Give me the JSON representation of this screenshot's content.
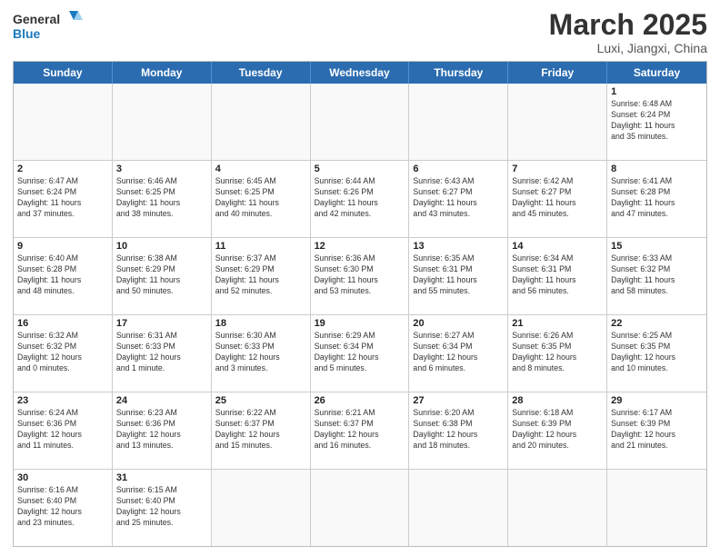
{
  "header": {
    "logo_general": "General",
    "logo_blue": "Blue",
    "month_title": "March 2025",
    "subtitle": "Luxi, Jiangxi, China"
  },
  "weekdays": [
    "Sunday",
    "Monday",
    "Tuesday",
    "Wednesday",
    "Thursday",
    "Friday",
    "Saturday"
  ],
  "weeks": [
    [
      {
        "day": "",
        "info": ""
      },
      {
        "day": "",
        "info": ""
      },
      {
        "day": "",
        "info": ""
      },
      {
        "day": "",
        "info": ""
      },
      {
        "day": "",
        "info": ""
      },
      {
        "day": "",
        "info": ""
      },
      {
        "day": "1",
        "info": "Sunrise: 6:48 AM\nSunset: 6:24 PM\nDaylight: 11 hours\nand 35 minutes."
      }
    ],
    [
      {
        "day": "2",
        "info": "Sunrise: 6:47 AM\nSunset: 6:24 PM\nDaylight: 11 hours\nand 37 minutes."
      },
      {
        "day": "3",
        "info": "Sunrise: 6:46 AM\nSunset: 6:25 PM\nDaylight: 11 hours\nand 38 minutes."
      },
      {
        "day": "4",
        "info": "Sunrise: 6:45 AM\nSunset: 6:25 PM\nDaylight: 11 hours\nand 40 minutes."
      },
      {
        "day": "5",
        "info": "Sunrise: 6:44 AM\nSunset: 6:26 PM\nDaylight: 11 hours\nand 42 minutes."
      },
      {
        "day": "6",
        "info": "Sunrise: 6:43 AM\nSunset: 6:27 PM\nDaylight: 11 hours\nand 43 minutes."
      },
      {
        "day": "7",
        "info": "Sunrise: 6:42 AM\nSunset: 6:27 PM\nDaylight: 11 hours\nand 45 minutes."
      },
      {
        "day": "8",
        "info": "Sunrise: 6:41 AM\nSunset: 6:28 PM\nDaylight: 11 hours\nand 47 minutes."
      }
    ],
    [
      {
        "day": "9",
        "info": "Sunrise: 6:40 AM\nSunset: 6:28 PM\nDaylight: 11 hours\nand 48 minutes."
      },
      {
        "day": "10",
        "info": "Sunrise: 6:38 AM\nSunset: 6:29 PM\nDaylight: 11 hours\nand 50 minutes."
      },
      {
        "day": "11",
        "info": "Sunrise: 6:37 AM\nSunset: 6:29 PM\nDaylight: 11 hours\nand 52 minutes."
      },
      {
        "day": "12",
        "info": "Sunrise: 6:36 AM\nSunset: 6:30 PM\nDaylight: 11 hours\nand 53 minutes."
      },
      {
        "day": "13",
        "info": "Sunrise: 6:35 AM\nSunset: 6:31 PM\nDaylight: 11 hours\nand 55 minutes."
      },
      {
        "day": "14",
        "info": "Sunrise: 6:34 AM\nSunset: 6:31 PM\nDaylight: 11 hours\nand 56 minutes."
      },
      {
        "day": "15",
        "info": "Sunrise: 6:33 AM\nSunset: 6:32 PM\nDaylight: 11 hours\nand 58 minutes."
      }
    ],
    [
      {
        "day": "16",
        "info": "Sunrise: 6:32 AM\nSunset: 6:32 PM\nDaylight: 12 hours\nand 0 minutes."
      },
      {
        "day": "17",
        "info": "Sunrise: 6:31 AM\nSunset: 6:33 PM\nDaylight: 12 hours\nand 1 minute."
      },
      {
        "day": "18",
        "info": "Sunrise: 6:30 AM\nSunset: 6:33 PM\nDaylight: 12 hours\nand 3 minutes."
      },
      {
        "day": "19",
        "info": "Sunrise: 6:29 AM\nSunset: 6:34 PM\nDaylight: 12 hours\nand 5 minutes."
      },
      {
        "day": "20",
        "info": "Sunrise: 6:27 AM\nSunset: 6:34 PM\nDaylight: 12 hours\nand 6 minutes."
      },
      {
        "day": "21",
        "info": "Sunrise: 6:26 AM\nSunset: 6:35 PM\nDaylight: 12 hours\nand 8 minutes."
      },
      {
        "day": "22",
        "info": "Sunrise: 6:25 AM\nSunset: 6:35 PM\nDaylight: 12 hours\nand 10 minutes."
      }
    ],
    [
      {
        "day": "23",
        "info": "Sunrise: 6:24 AM\nSunset: 6:36 PM\nDaylight: 12 hours\nand 11 minutes."
      },
      {
        "day": "24",
        "info": "Sunrise: 6:23 AM\nSunset: 6:36 PM\nDaylight: 12 hours\nand 13 minutes."
      },
      {
        "day": "25",
        "info": "Sunrise: 6:22 AM\nSunset: 6:37 PM\nDaylight: 12 hours\nand 15 minutes."
      },
      {
        "day": "26",
        "info": "Sunrise: 6:21 AM\nSunset: 6:37 PM\nDaylight: 12 hours\nand 16 minutes."
      },
      {
        "day": "27",
        "info": "Sunrise: 6:20 AM\nSunset: 6:38 PM\nDaylight: 12 hours\nand 18 minutes."
      },
      {
        "day": "28",
        "info": "Sunrise: 6:18 AM\nSunset: 6:39 PM\nDaylight: 12 hours\nand 20 minutes."
      },
      {
        "day": "29",
        "info": "Sunrise: 6:17 AM\nSunset: 6:39 PM\nDaylight: 12 hours\nand 21 minutes."
      }
    ],
    [
      {
        "day": "30",
        "info": "Sunrise: 6:16 AM\nSunset: 6:40 PM\nDaylight: 12 hours\nand 23 minutes."
      },
      {
        "day": "31",
        "info": "Sunrise: 6:15 AM\nSunset: 6:40 PM\nDaylight: 12 hours\nand 25 minutes."
      },
      {
        "day": "",
        "info": ""
      },
      {
        "day": "",
        "info": ""
      },
      {
        "day": "",
        "info": ""
      },
      {
        "day": "",
        "info": ""
      },
      {
        "day": "",
        "info": ""
      }
    ]
  ]
}
